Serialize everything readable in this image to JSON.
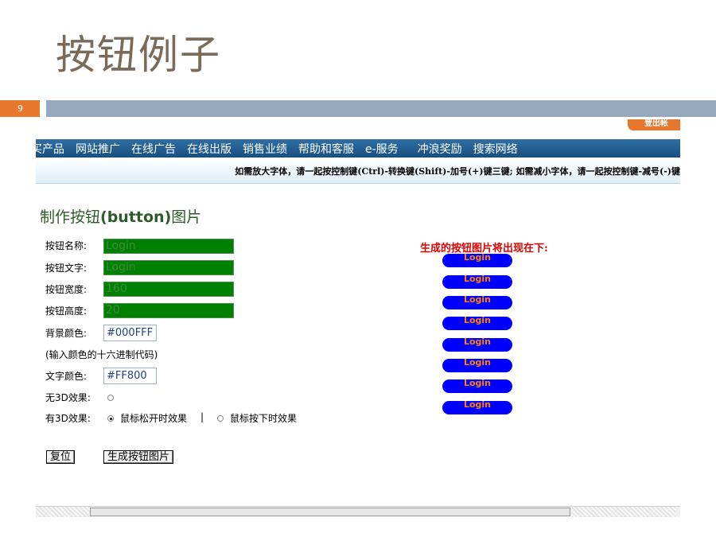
{
  "slide": {
    "title": "按钮例子",
    "page_number": "9"
  },
  "colors": {
    "accent_orange": "#e8772e",
    "slide_bar": "#93a9bd",
    "nav_blue": "#1a4f80",
    "input_green": "#008000",
    "pill_blue": "#0000ff",
    "pill_text": "#ff8000",
    "result_red": "#e00000"
  },
  "top_tab": {
    "label": "登出帐"
  },
  "nav": {
    "items": [
      "买产品",
      "网站推广",
      "在线广告",
      "在线出版",
      "销售业绩",
      "帮助和客服",
      "e-服务",
      "冲浪奖励",
      "搜索网络"
    ]
  },
  "hint": {
    "text": "如需放大字体，请一起按控制键(Ctrl)-转换键(Shift)-加号(+)键三键; 如需减小字体，请一起按控制键-减号(-)键"
  },
  "form": {
    "heading_prefix": "制作按钮",
    "heading_bold": "(button)",
    "heading_suffix": "图片",
    "name_label": "按钮名称:",
    "name_value": "Login",
    "text_label": "按钮文字:",
    "text_value": "Login",
    "width_label": "按钮宽度:",
    "width_value": "160",
    "height_label": "按钮高度:",
    "height_value": "20",
    "bg_label": "背景颜色:",
    "bg_value": "#000FFF",
    "hex_hint": "(输入颜色的十六进制代码)",
    "fg_label": "文字颜色:",
    "fg_value": "#FF800",
    "no3d_label": "无3D效果:",
    "with3d_label": "有3D效果:",
    "release_label": "鼠标松开时效果",
    "separator": "|",
    "press_label": "鼠标按下时效果",
    "reset_button": "复位",
    "generate_button": "生成按钮图片"
  },
  "result": {
    "heading": "生成的按钮图片将出现在下:",
    "buttons": [
      "Login",
      "Login",
      "Login",
      "Login",
      "Login",
      "Login",
      "Login",
      "Login"
    ]
  }
}
